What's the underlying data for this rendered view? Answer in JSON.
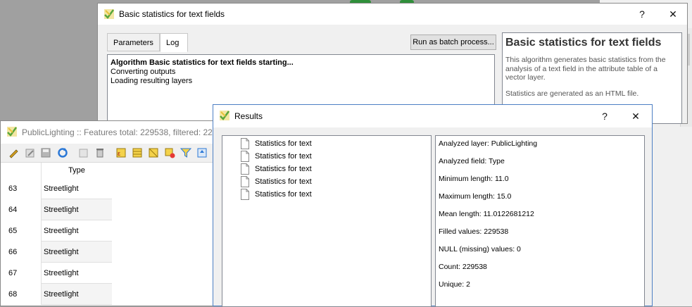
{
  "basic_stats_dialog": {
    "title": "Basic statistics for text fields",
    "help_btn": "?",
    "close_btn": "✕",
    "tabs": [
      {
        "label": "Parameters"
      },
      {
        "label": "Log",
        "active": true
      }
    ],
    "batch_button": "Run as batch process...",
    "log_lines": [
      "Algorithm Basic statistics for text fields starting...",
      "Converting outputs",
      "Loading resulting layers"
    ],
    "help_title": "Basic statistics for text fields",
    "help_text_1": "This algorithm generates basic statistics from the analysis of a text field in the attribute table of a vector layer.",
    "help_text_2": "Statistics are generated as an HTML file."
  },
  "attribute_table": {
    "title": "PublicLighting :: Features total: 229538, filtered: 22",
    "column_header": "Type",
    "rows": [
      {
        "idx": "63",
        "value": "Streetlight"
      },
      {
        "idx": "64",
        "value": "Streetlight"
      },
      {
        "idx": "65",
        "value": "Streetlight"
      },
      {
        "idx": "66",
        "value": "Streetlight"
      },
      {
        "idx": "67",
        "value": "Streetlight"
      },
      {
        "idx": "68",
        "value": "Streetlight"
      }
    ]
  },
  "results_dialog": {
    "title": "Results",
    "help_btn": "?",
    "close_btn": "✕",
    "results_list": [
      "Statistics for text",
      "Statistics for text",
      "Statistics for text",
      "Statistics for text",
      "Statistics for text"
    ],
    "output_lines": [
      "Analyzed layer: PublicLighting",
      "Analyzed field: Type",
      "Minimum length: 11.0",
      "Maximum length: 15.0",
      "Mean length: 11.0122681212",
      "Filled values: 229538",
      "NULL (missing) values: 0",
      "Count: 229538",
      "Unique: 2"
    ]
  },
  "colors": {
    "window_bg": "#f0f0f0",
    "accent_border": "#4d7fc4",
    "qgis_green": "#58a63c",
    "qgis_yellow": "#e8c33a"
  }
}
